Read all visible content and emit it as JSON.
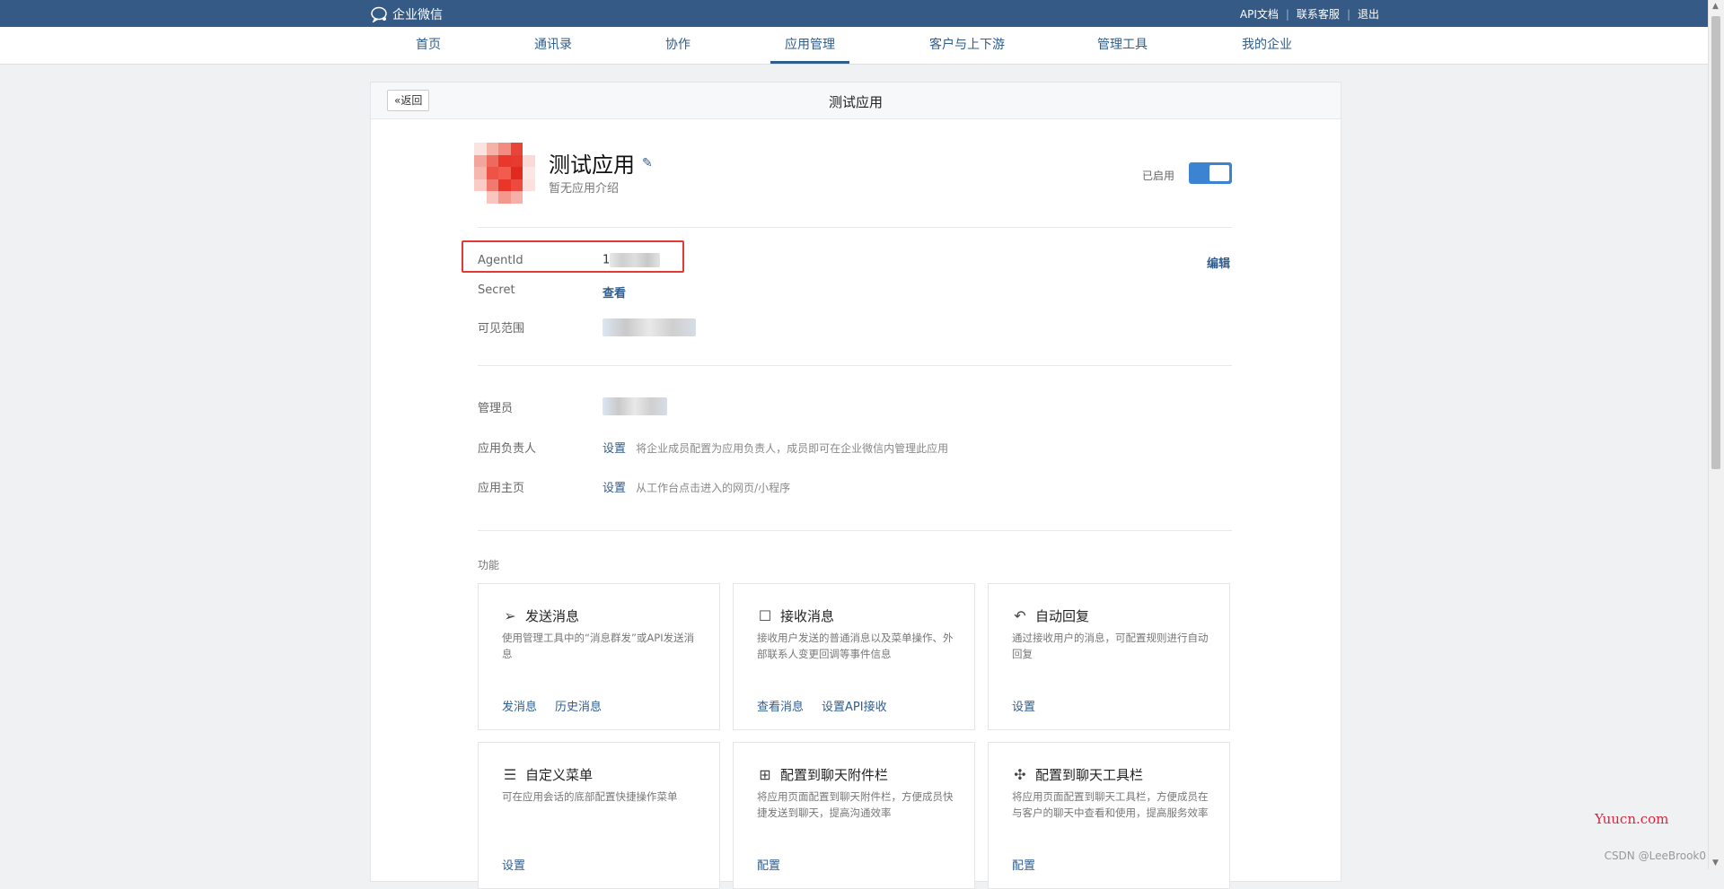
{
  "topbar": {
    "logo_text": "企业微信",
    "links": [
      "API文档",
      "联系客服",
      "退出"
    ]
  },
  "nav": {
    "items": [
      "首页",
      "通讯录",
      "协作",
      "应用管理",
      "客户与上下游",
      "管理工具",
      "我的企业"
    ],
    "active": "应用管理"
  },
  "page": {
    "back_label": "返回",
    "title": "测试应用"
  },
  "app": {
    "name": "测试应用",
    "desc": "暂无应用介绍",
    "enabled_label": "已启用",
    "enabled": true
  },
  "info": {
    "agentid_label": "AgentId",
    "agentid_value": "1",
    "edit_label": "编辑",
    "secret_label": "Secret",
    "secret_action": "查看",
    "scope_label": "可见范围"
  },
  "roles": {
    "admin_label": "管理员",
    "owner_label": "应用负责人",
    "owner_action": "设置",
    "owner_hint": "将企业成员配置为应用负责人，成员即可在企业微信内管理此应用",
    "home_label": "应用主页",
    "home_action": "设置",
    "home_hint": "从工作台点击进入的网页/小程序"
  },
  "features": {
    "section_title": "功能",
    "cards": [
      {
        "title": "发送消息",
        "icon": "send-icon",
        "desc": "使用管理工具中的“消息群发”或API发送消息",
        "actions": [
          "发消息",
          "历史消息"
        ]
      },
      {
        "title": "接收消息",
        "icon": "chat-bubble-icon",
        "desc": "接收用户发送的普通消息以及菜单操作、外部联系人变更回调等事件信息",
        "actions": [
          "查看消息",
          "设置API接收"
        ]
      },
      {
        "title": "自动回复",
        "icon": "reply-icon",
        "desc": "通过接收用户的消息，可配置规则进行自动回复",
        "actions": [
          "设置"
        ]
      },
      {
        "title": "自定义菜单",
        "icon": "menu-icon",
        "desc": "可在应用会话的底部配置快捷操作菜单",
        "actions": [
          "设置"
        ]
      },
      {
        "title": "配置到聊天附件栏",
        "icon": "attachment-grid-icon",
        "desc": "将应用页面配置到聊天附件栏，方便成员快捷发送到聊天，提高沟通效率",
        "actions": [
          "配置"
        ]
      },
      {
        "title": "配置到聊天工具栏",
        "icon": "toolbar-icon",
        "desc": "将应用页面配置到聊天工具栏，方便成员在与客户的聊天中查看和使用，提高服务效率",
        "actions": [
          "配置"
        ]
      }
    ]
  },
  "watermarks": {
    "site": "Yuucn.com",
    "csdn": "CSDN @LeeBrook0"
  },
  "colors": {
    "topbar": "#355a85",
    "link": "#2f5d8e",
    "toggle": "#3c84d2",
    "highlight": "#e53935"
  }
}
